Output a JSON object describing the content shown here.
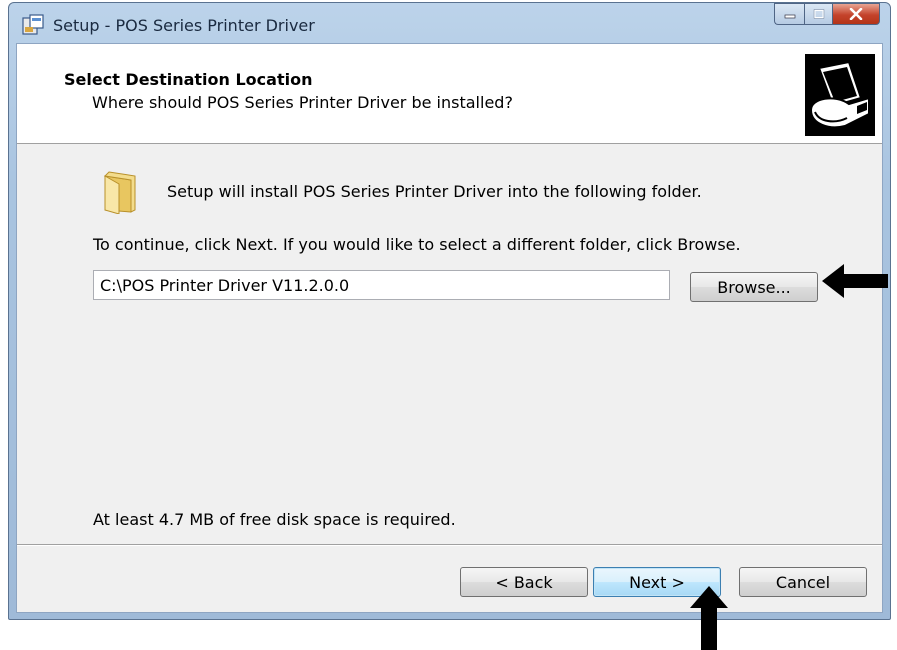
{
  "window": {
    "title": "Setup - POS Series Printer Driver"
  },
  "header": {
    "title": "Select Destination Location",
    "subtitle": "Where should POS Series Printer Driver be installed?"
  },
  "body": {
    "intro": "Setup will install POS Series Printer Driver into the following folder.",
    "instruction": "To continue, click Next. If you would like to select a different folder, click Browse.",
    "path_value": "C:\\POS Printer Driver V11.2.0.0",
    "browse_label": "Browse...",
    "diskspace": "At least 4.7 MB of free disk space is required."
  },
  "footer": {
    "back_label": "< Back",
    "next_label": "Next >",
    "cancel_label": "Cancel"
  },
  "icons": {
    "app": "setup-icon",
    "header": "printer-install-icon",
    "folder": "folder-icon",
    "annotation_right": "arrow-left-icon",
    "annotation_up": "arrow-up-icon"
  },
  "colors": {
    "close_button": "#c4432b",
    "next_button": "#bee6fd"
  }
}
